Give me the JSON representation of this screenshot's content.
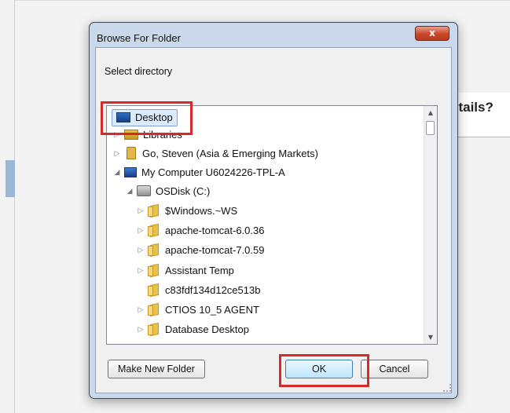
{
  "background": {
    "heading_fragment": "etails?"
  },
  "dialog": {
    "title": "Browse For Folder",
    "close_glyph": "x",
    "description": "Select directory",
    "buttons": {
      "new_folder": "Make New Folder",
      "ok": "OK",
      "cancel": "Cancel"
    }
  },
  "tree": {
    "items": [
      {
        "label": "Desktop",
        "icon": "desktop-icon",
        "expander": "",
        "selected": true
      },
      {
        "label": "Libraries",
        "icon": "libraries-icon",
        "expander": "▷"
      },
      {
        "label": "Go, Steven (Asia & Emerging Markets)",
        "icon": "user-folder-icon",
        "expander": "▷"
      },
      {
        "label": "My Computer U6024226-TPL-A",
        "icon": "computer-icon",
        "expander": "◢"
      },
      {
        "label": "OSDisk (C:)",
        "icon": "drive-icon",
        "expander": "◢"
      },
      {
        "label": "$Windows.~WS",
        "icon": "folder-icon",
        "expander": "▷"
      },
      {
        "label": "apache-tomcat-6.0.36",
        "icon": "folder-icon",
        "expander": "▷"
      },
      {
        "label": "apache-tomcat-7.0.59",
        "icon": "folder-icon",
        "expander": "▷"
      },
      {
        "label": "Assistant Temp",
        "icon": "folder-icon",
        "expander": "▷"
      },
      {
        "label": "c83fdf134d12ce513b",
        "icon": "folder-icon",
        "expander": ""
      },
      {
        "label": "CTIOS 10_5 AGENT",
        "icon": "folder-icon",
        "expander": "▷"
      },
      {
        "label": "Database Desktop",
        "icon": "folder-icon",
        "expander": "▷"
      }
    ],
    "scrollbar": {
      "up_glyph": "▲",
      "down_glyph": "▼"
    }
  },
  "colors": {
    "highlight": "#d42a2a",
    "selection": "#dcebfc",
    "title_bar": "#c9d8ea"
  }
}
